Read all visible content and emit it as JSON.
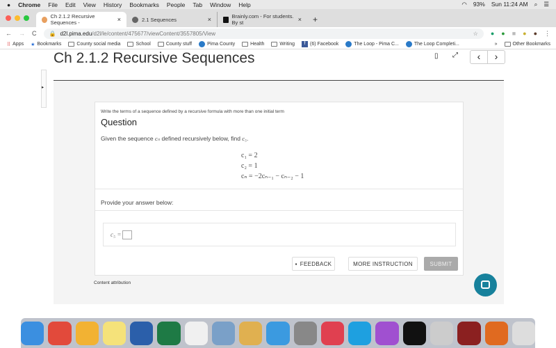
{
  "menubar": {
    "apple": "",
    "items": [
      "Chrome",
      "File",
      "Edit",
      "View",
      "History",
      "Bookmarks",
      "People",
      "Tab",
      "Window",
      "Help"
    ],
    "battery": "93%",
    "clock": "Sun 11:24 AM"
  },
  "tabs": [
    {
      "label": "Ch 2.1.2 Recursive Sequences -",
      "color": "#e8a060"
    },
    {
      "label": "2.1 Sequences",
      "color": "#666"
    },
    {
      "label": "Brainly.com - For students. By st",
      "color": "#111"
    }
  ],
  "address": {
    "domain": "d2l.pima.edu",
    "path": "/d2l/le/content/475677/viewContent/3557805/View"
  },
  "bookmarks": [
    "Apps",
    "Bookmarks",
    "County social media",
    "School",
    "County stuff",
    "Pima County",
    "Health",
    "Writing",
    "(6) Facebook",
    "The Loop - Pima C...",
    "The Loop Completi..."
  ],
  "other_bookmarks": "Other Bookmarks",
  "page": {
    "title": "Ch 2.1.2 Recursive Sequences",
    "prev": "‹",
    "next": "›"
  },
  "question": {
    "subtitle": "Write the terms of a sequence defined by a recursive formula with more than one initial term",
    "heading": "Question",
    "given_pre": "Given the sequence ",
    "seq": "cₙ",
    "given_mid": " defined recursively below, find ",
    "target": "c₅",
    "given_end": ".",
    "eq1": "c₁ = 2",
    "eq2": "c₂ = 1",
    "eq3": "cₙ = −2cₙ₋₁ − cₙ₋₂ − 1",
    "prompt": "Provide your answer below:",
    "answer_label": "c₅ =",
    "answer_value": ""
  },
  "buttons": {
    "feedback": "FEEDBACK",
    "more": "MORE INSTRUCTION",
    "submit": "SUBMIT"
  },
  "attribution": "Content attribution",
  "dock_colors": [
    "#3b8fe0",
    "#e24a3b",
    "#f2b233",
    "#f5e27a",
    "#2b5faa",
    "#1e7a45",
    "#f0f0f0",
    "#7aa0c8",
    "#e0b050",
    "#3b9ae0",
    "#888",
    "#e04050",
    "#1ea0e0",
    "#a050d0",
    "#111",
    "#ccc",
    "#8b2020",
    "#e06a20",
    "#ddd"
  ]
}
